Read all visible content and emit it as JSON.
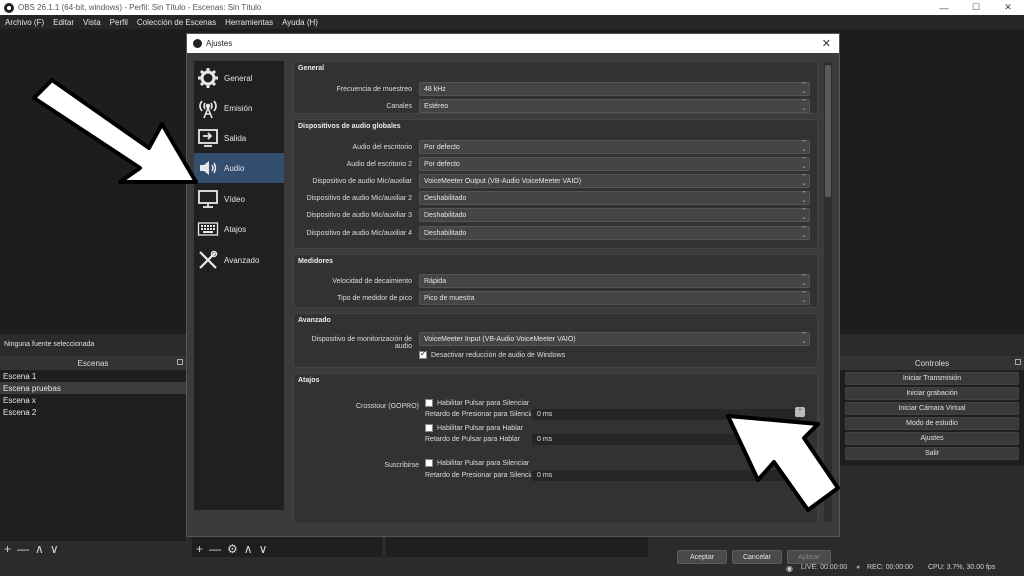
{
  "window": {
    "title": "OBS 26.1.1 (64-bit, windows) - Perfil: Sin Título - Escenas: Sin Título",
    "minimize": "—",
    "maximize": "☐",
    "close": "✕"
  },
  "menu": [
    "Archivo (F)",
    "Editar",
    "Vista",
    "Perfil",
    "Colección de Escenas",
    "Herramientas",
    "Ayuda (H)"
  ],
  "sources_status": "Ninguna fuente seleccionada",
  "scenes": {
    "header": "Escenas",
    "items": [
      "Escena 1",
      "Escena pruebas",
      "Escena x",
      "Escena 2"
    ],
    "selected_index": 1
  },
  "controls": {
    "header": "Controles",
    "buttons": [
      "Iniciar Transmisión",
      "Iniciar grabación",
      "Iniciar Cámara Virtual",
      "Modo de estudio",
      "Ajustes",
      "Salir"
    ]
  },
  "status": {
    "live": "LIVE: 00:00:00",
    "rec": "REC: 00:00:00",
    "cpu": "CPU: 3.7%, 30.00 fps"
  },
  "toolbar_glyphs": {
    "add": "+",
    "remove": "—",
    "up": "∧",
    "down": "∨",
    "gear": "⚙"
  },
  "dialog": {
    "title": "Ajustes",
    "close": "✕",
    "sidebar": [
      {
        "label": "General",
        "icon": "gear-icon"
      },
      {
        "label": "Emisión",
        "icon": "broadcast-icon"
      },
      {
        "label": "Salida",
        "icon": "output-icon"
      },
      {
        "label": "Audio",
        "icon": "speaker-icon"
      },
      {
        "label": "Vídeo",
        "icon": "monitor-icon"
      },
      {
        "label": "Atajos",
        "icon": "keyboard-icon"
      },
      {
        "label": "Avanzado",
        "icon": "tools-icon"
      }
    ],
    "active_sidebar": "Audio",
    "general": {
      "title": "General",
      "sample_rate_label": "Frecuencia de muestreo",
      "sample_rate": "48 kHz",
      "channels_label": "Canales",
      "channels": "Estéreo"
    },
    "global_devices": {
      "title": "Dispositivos de audio globales",
      "rows": [
        {
          "label": "Audio del escritorio",
          "value": "Por defecto"
        },
        {
          "label": "Audio del escritorio 2",
          "value": "Por defecto"
        },
        {
          "label": "Dispositivo de audio Mic/auxiliar",
          "value": "VoiceMeeter Output (VB-Audio VoiceMeeter VAIO)"
        },
        {
          "label": "Dispositivo de audio Mic/auxiliar 2",
          "value": "Deshabilitado"
        },
        {
          "label": "Dispositivo de audio Mic/auxiliar 3",
          "value": "Deshabilitado"
        },
        {
          "label": "Dispositivo de audio Mic/auxiliar 4",
          "value": "Deshabilitado"
        }
      ]
    },
    "meters": {
      "title": "Medidores",
      "decay_label": "Velocidad de decaimiento",
      "decay": "Rápida",
      "peak_label": "Tipo de medidor de pico",
      "peak": "Pico de muestra"
    },
    "advanced": {
      "title": "Avanzado",
      "monitor_label": "Dispositivo de monitorización de audio",
      "monitor": "VoiceMeeter Input (VB-Audio VoiceMeeter VAIO)",
      "ducking_label": "Desactivar reducción de audio de Windows",
      "ducking_checked": true
    },
    "hotkeys": {
      "title": "Atajos",
      "sources": [
        {
          "name": "Crosstour (GOPRO)",
          "mute_label": "Habilitar Pulsar para Silenciar",
          "mute_delay_label": "Retardo de Presionar para Silenciar",
          "mute_delay": "0 ms",
          "talk_label": "Habilitar Pulsar para Hablar",
          "talk_delay_label": "Retardo de Pulsar para Hablar",
          "talk_delay": "0 ms"
        },
        {
          "name": "Suscribirse",
          "mute_label": "Habilitar Pulsar para Silenciar",
          "mute_delay_label": "Retardo de Presionar para Silenciar",
          "mute_delay": "0 ms"
        }
      ]
    },
    "buttons": {
      "accept": "Aceptar",
      "cancel": "Cancelar",
      "apply": "Aplicar"
    }
  }
}
